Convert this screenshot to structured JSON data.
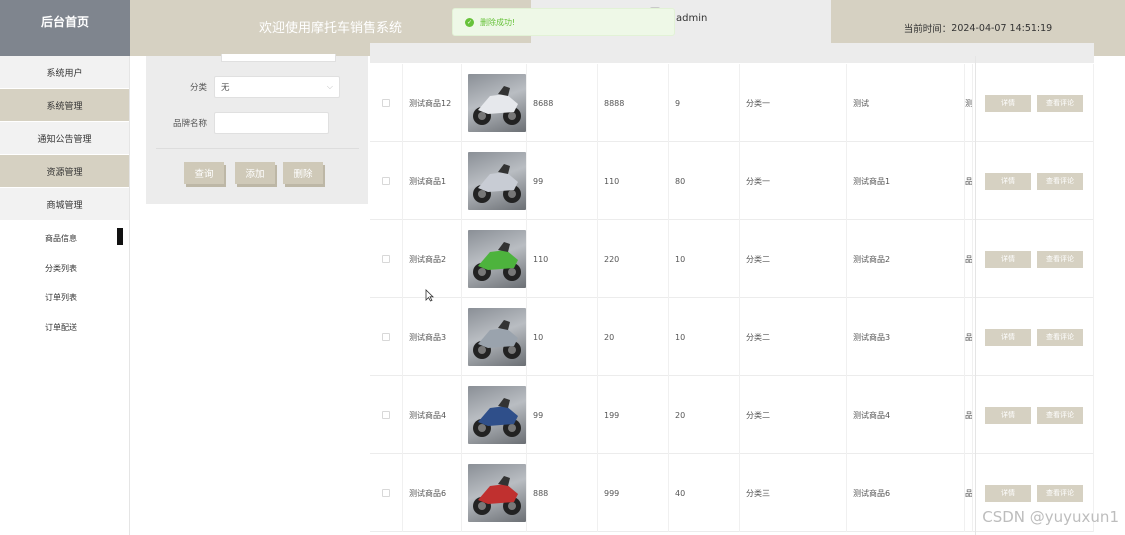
{
  "header": {
    "logo_text": "后台首页",
    "welcome": "欢迎使用摩托车销售系统",
    "user": "admin",
    "time_label": "当前时间：",
    "time_value": "2024-04-07 14:51:19"
  },
  "toast": {
    "message": "删除成功!"
  },
  "sidebar": {
    "items": [
      {
        "label": "系统用户",
        "style": "plain"
      },
      {
        "label": "系统管理",
        "style": "alt"
      },
      {
        "label": "通知公告管理",
        "style": "plain"
      },
      {
        "label": "资源管理",
        "style": "alt"
      },
      {
        "label": "商城管理",
        "style": "plain"
      }
    ],
    "sub_items": [
      {
        "label": "商品信息",
        "active": true
      },
      {
        "label": "分类列表",
        "active": false
      },
      {
        "label": "订单列表",
        "active": false
      },
      {
        "label": "订单配送",
        "active": false
      }
    ]
  },
  "search": {
    "category_label": "分类",
    "category_value": "无",
    "brand_label": "品牌名称",
    "brand_value": "",
    "query_button": "查询",
    "add_button": "添加",
    "delete_button": "删除"
  },
  "table": {
    "rows": [
      {
        "name": "测试商品12",
        "price": "8688",
        "original": "8888",
        "stock": "9",
        "category": "分类一",
        "desc": "测试",
        "extra": "测",
        "color": "#e6e8ec"
      },
      {
        "name": "测试商品1",
        "price": "99",
        "original": "110",
        "stock": "80",
        "category": "分类一",
        "desc": "测试商品1",
        "extra": "品",
        "color": "#c8ccd4"
      },
      {
        "name": "测试商品2",
        "price": "110",
        "original": "220",
        "stock": "10",
        "category": "分类二",
        "desc": "测试商品2",
        "extra": "品",
        "color": "#4db33d"
      },
      {
        "name": "测试商品3",
        "price": "10",
        "original": "20",
        "stock": "10",
        "category": "分类二",
        "desc": "测试商品3",
        "extra": "品",
        "color": "#9aa3ad"
      },
      {
        "name": "测试商品4",
        "price": "99",
        "original": "199",
        "stock": "20",
        "category": "分类二",
        "desc": "测试商品4",
        "extra": "品",
        "color": "#2f4f8a"
      },
      {
        "name": "测试商品6",
        "price": "888",
        "original": "999",
        "stock": "40",
        "category": "分类三",
        "desc": "测试商品6",
        "extra": "品",
        "color": "#c0302f"
      }
    ],
    "detail_button": "详情",
    "review_button": "查看评论"
  },
  "watermark": "CSDN @yuyuxun1"
}
